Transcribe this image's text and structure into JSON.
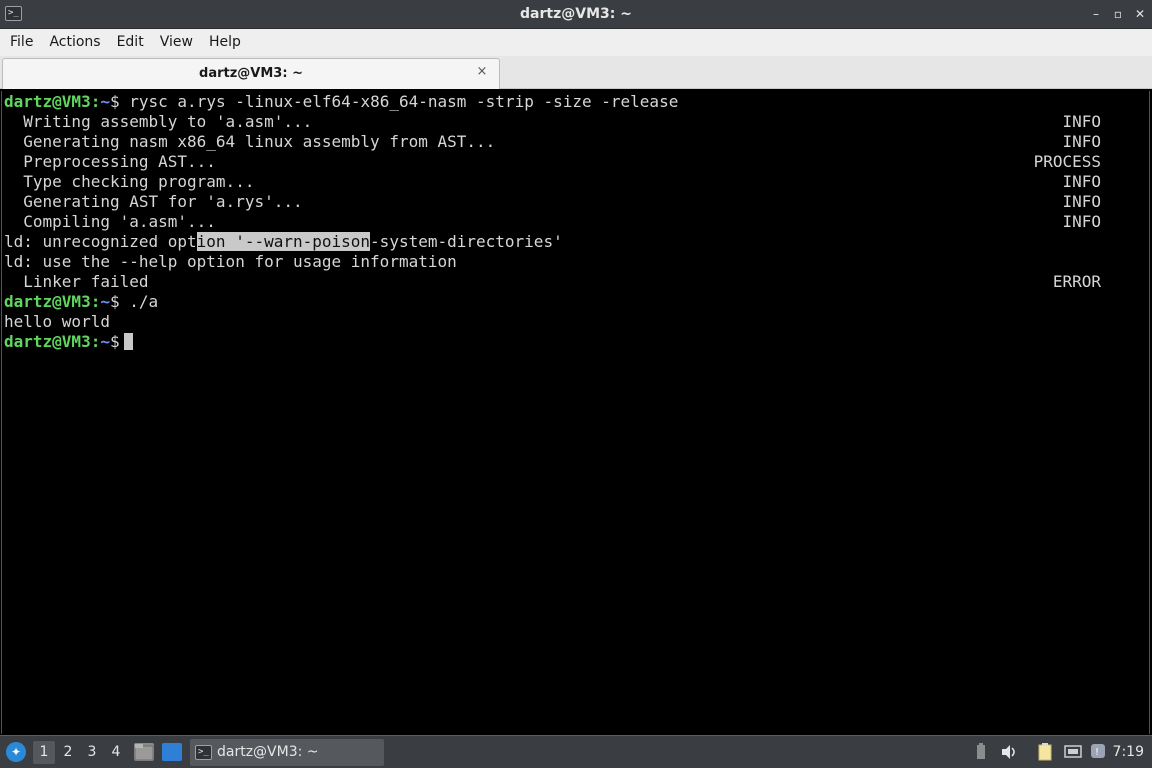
{
  "window": {
    "title": "dartz@VM3: ~",
    "app_icon_glyph": ">_",
    "minimize_glyph": "–",
    "maximize_glyph": "▫",
    "close_glyph": "✕"
  },
  "menu": {
    "items": [
      "File",
      "Actions",
      "Edit",
      "View",
      "Help"
    ]
  },
  "tabs": [
    {
      "label": "dartz@VM3: ~",
      "close_glyph": "×"
    }
  ],
  "colors": {
    "prompt_user": "#5fd75f",
    "prompt_dir": "#6f8fff",
    "terminal_bg": "#000000",
    "terminal_fg": "#d6d6d6",
    "taskbar_bg": "#3a3d42"
  },
  "terminal": {
    "prompt_user": "dartz@VM3",
    "prompt_sep": ":",
    "prompt_dir": "~",
    "prompt_symbol": "$",
    "cmd1": " rysc a.rys -linux-elf64-x86_64-nasm -strip -size -release",
    "log": [
      {
        "text": "  Writing assembly to 'a.asm'...",
        "status": "INFO"
      },
      {
        "text": "  Generating nasm x86_64 linux assembly from AST...",
        "status": "INFO"
      },
      {
        "text": "  Preprocessing AST...",
        "status": "PROCESS"
      },
      {
        "text": "  Type checking program...",
        "status": "INFO"
      },
      {
        "text": "  Generating AST for 'a.rys'...",
        "status": "INFO"
      },
      {
        "text": "  Compiling 'a.asm'...",
        "status": "INFO"
      }
    ],
    "ld_error_pre": "ld: unrecognized opt",
    "ld_error_sel": "ion '--warn-poison",
    "ld_error_post": "-system-directories'",
    "ld_help": "ld: use the --help option for usage information",
    "linker_failed": {
      "text": "  Linker failed",
      "status": "ERROR"
    },
    "cmd2": " ./a",
    "output": "hello world",
    "cmd3": " "
  },
  "taskbar": {
    "workspaces": [
      "1",
      "2",
      "3",
      "4"
    ],
    "active_workspace": "1",
    "task_label": "dartz@VM3: ~",
    "task_icon_glyph": ">_",
    "clock": "7:19"
  }
}
